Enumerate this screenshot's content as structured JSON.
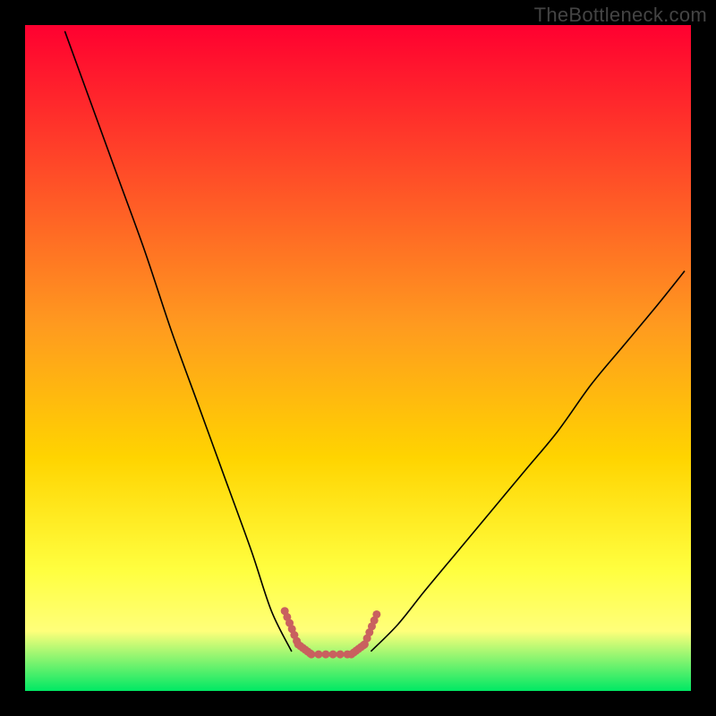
{
  "watermark": "TheBottleneck.com",
  "chart_data": {
    "type": "line",
    "title": "",
    "xlabel": "",
    "ylabel": "",
    "xlim": [
      0,
      100
    ],
    "ylim": [
      0,
      100
    ],
    "grid": false,
    "legend": false,
    "annotations": [],
    "background_gradient": {
      "top_color": "#ff0030",
      "mid_color": "#ffd400",
      "lower_color": "#ffff7a",
      "bottom_color": "#00e864"
    },
    "series": [
      {
        "name": "left-curve",
        "x": [
          6,
          10,
          14,
          18,
          22,
          26,
          30,
          34,
          37,
          40
        ],
        "values": [
          99,
          88,
          77,
          66,
          54,
          43,
          32,
          21,
          12,
          6
        ],
        "stroke": "#000000",
        "width": 1.6
      },
      {
        "name": "right-curve",
        "x": [
          52,
          56,
          60,
          65,
          70,
          75,
          80,
          85,
          90,
          95,
          99
        ],
        "values": [
          6,
          10,
          15,
          21,
          27,
          33,
          39,
          46,
          52,
          58,
          63
        ],
        "stroke": "#000000",
        "width": 1.6
      },
      {
        "name": "valley-highlight",
        "x": [
          39,
          41,
          43,
          49,
          51,
          53
        ],
        "values": [
          12,
          7,
          5.5,
          5.5,
          7,
          12
        ],
        "stroke": "#c9605f",
        "width": 9,
        "dotted": true
      }
    ]
  }
}
